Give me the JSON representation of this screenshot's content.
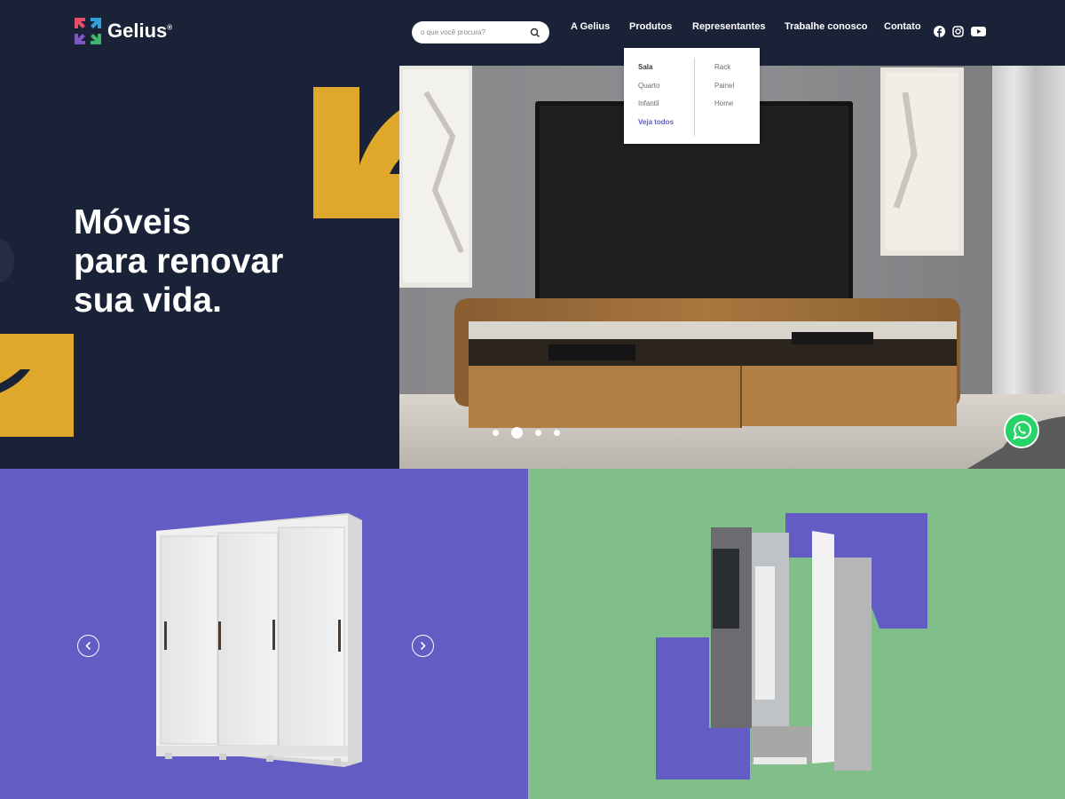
{
  "brand": {
    "name": "Gelius",
    "registered": "®"
  },
  "search": {
    "placeholder": "o que você procura?"
  },
  "nav": {
    "items": [
      {
        "label": "A Gelius"
      },
      {
        "label": "Produtos"
      },
      {
        "label": "Representantes"
      },
      {
        "label": "Trabalhe conosco"
      },
      {
        "label": "Contato"
      }
    ]
  },
  "social": [
    "facebook-icon",
    "instagram-icon",
    "youtube-icon"
  ],
  "dropdown": {
    "col1": [
      "Sala",
      "Quarto",
      "Infantil",
      "Veja todos"
    ],
    "col2": [
      "Rack",
      "Painel",
      "Home"
    ]
  },
  "hero": {
    "title_lines": [
      "Móveis",
      "para renovar",
      "sua vida."
    ],
    "slides": 4,
    "active_slide": 2
  },
  "colors": {
    "navy": "#1a2238",
    "yellow": "#e0a82a",
    "purple": "#625cc4",
    "green": "#80bf8a",
    "whatsapp": "#25d366"
  }
}
